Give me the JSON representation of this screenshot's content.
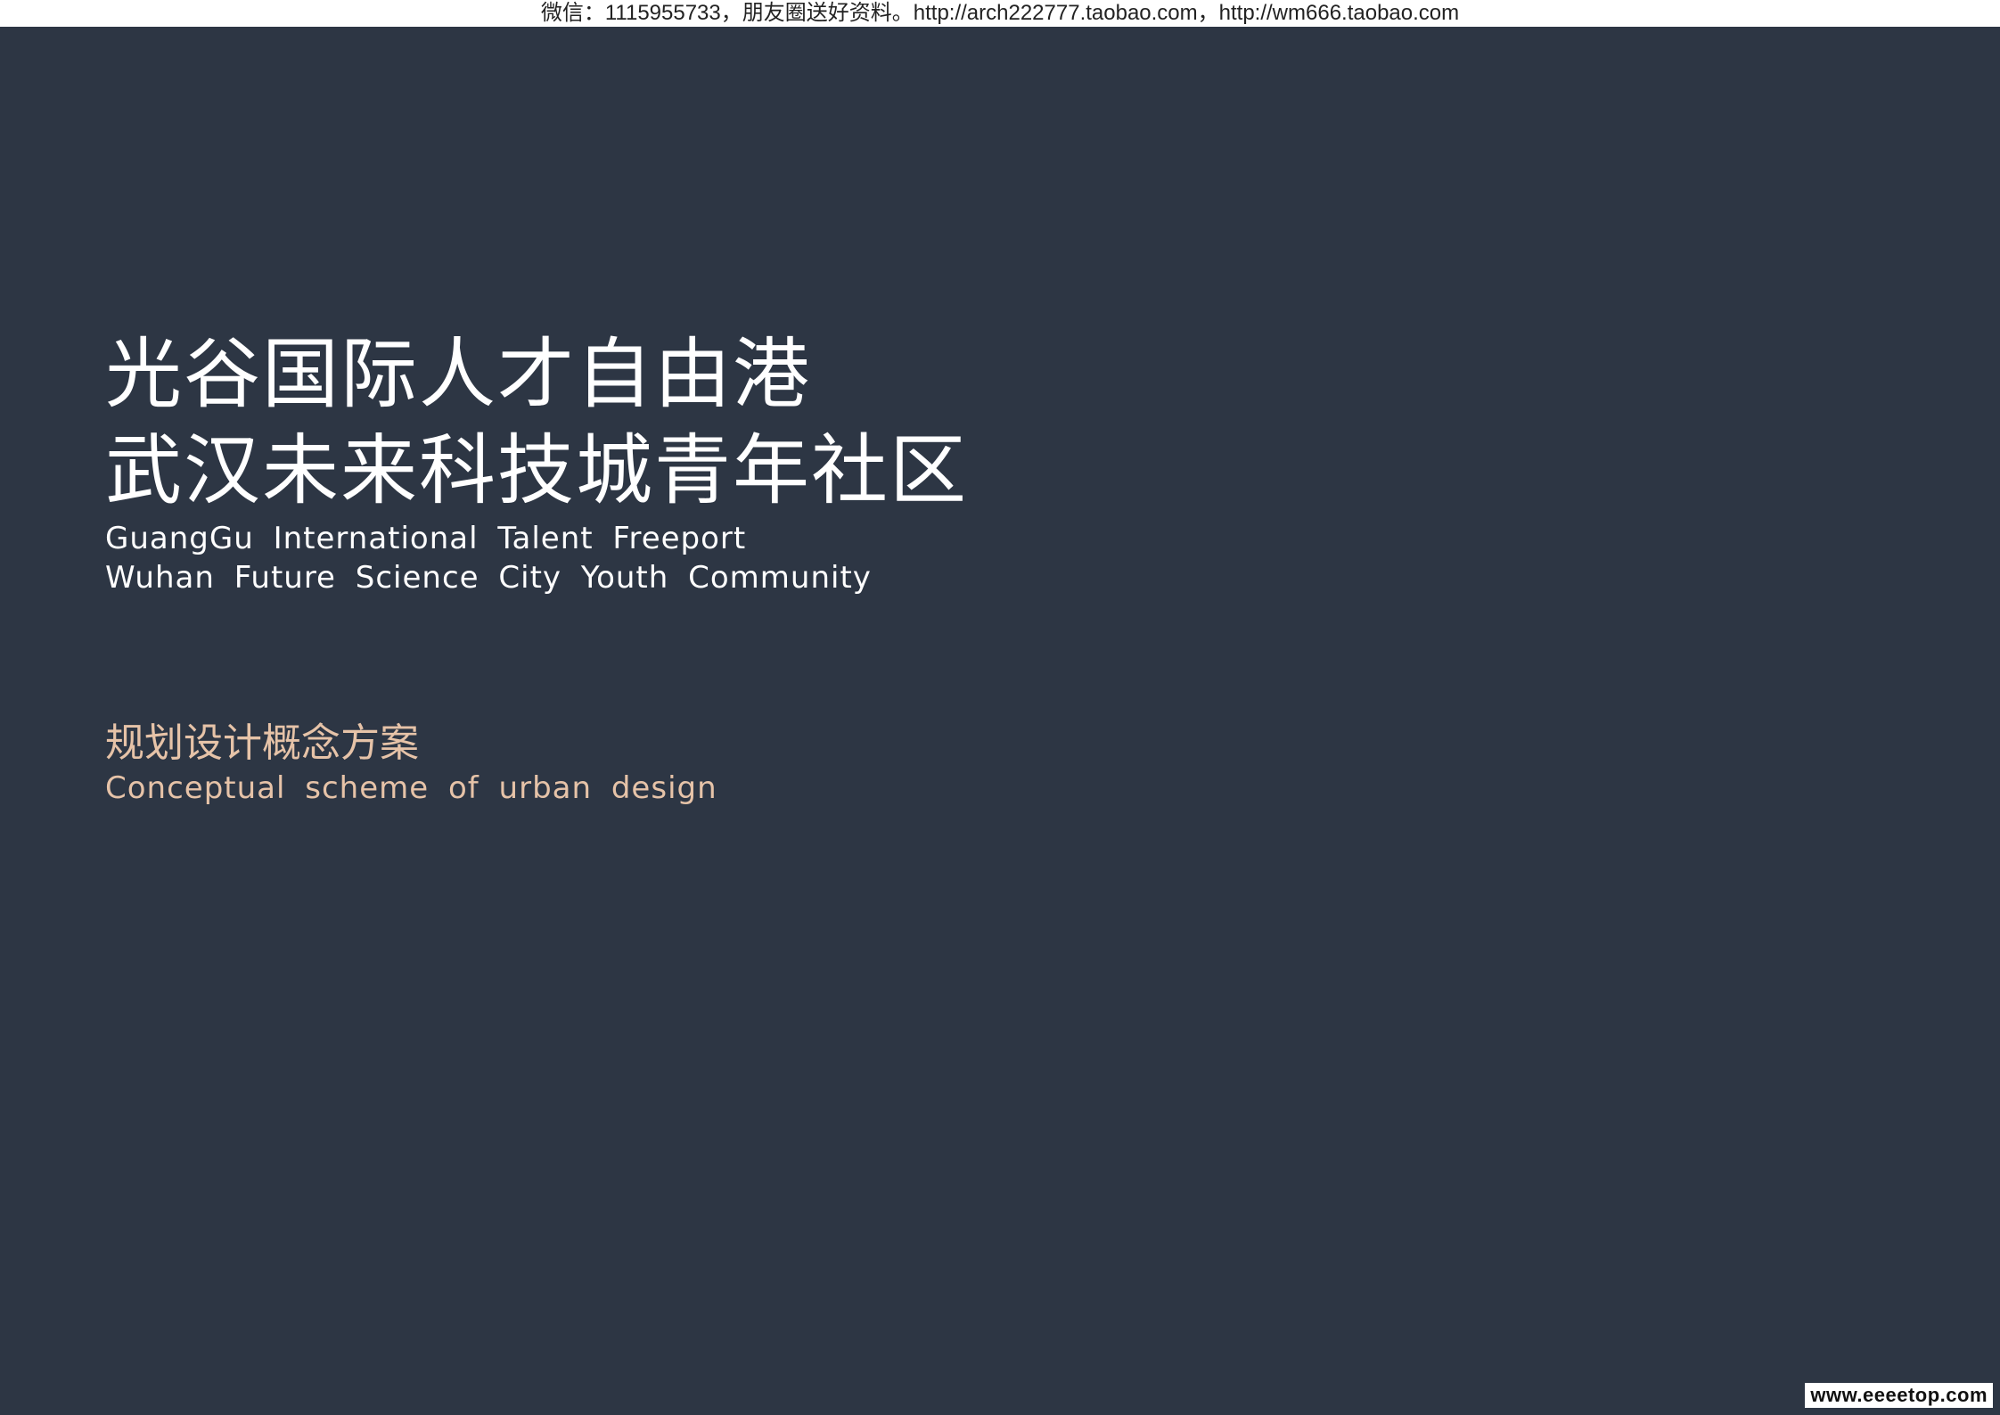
{
  "banner": {
    "text": "微信：1115955733，朋友圈送好资料。http://arch222777.taobao.com，http://wm666.taobao.com"
  },
  "title": {
    "cn_line1": "光谷国际人才自由港",
    "cn_line2": "武汉未来科技城青年社区",
    "en_line1": "GuangGu International Talent Freeport",
    "en_line2": "Wuhan Future Science City Youth Community"
  },
  "subtitle": {
    "cn": "规划设计概念方案",
    "en": "Conceptual scheme of urban design"
  },
  "watermark": {
    "text": "www.eeeetop.com"
  },
  "colors": {
    "background": "#2d3644",
    "title": "#ffffff",
    "accent": "#e6c3a8"
  }
}
